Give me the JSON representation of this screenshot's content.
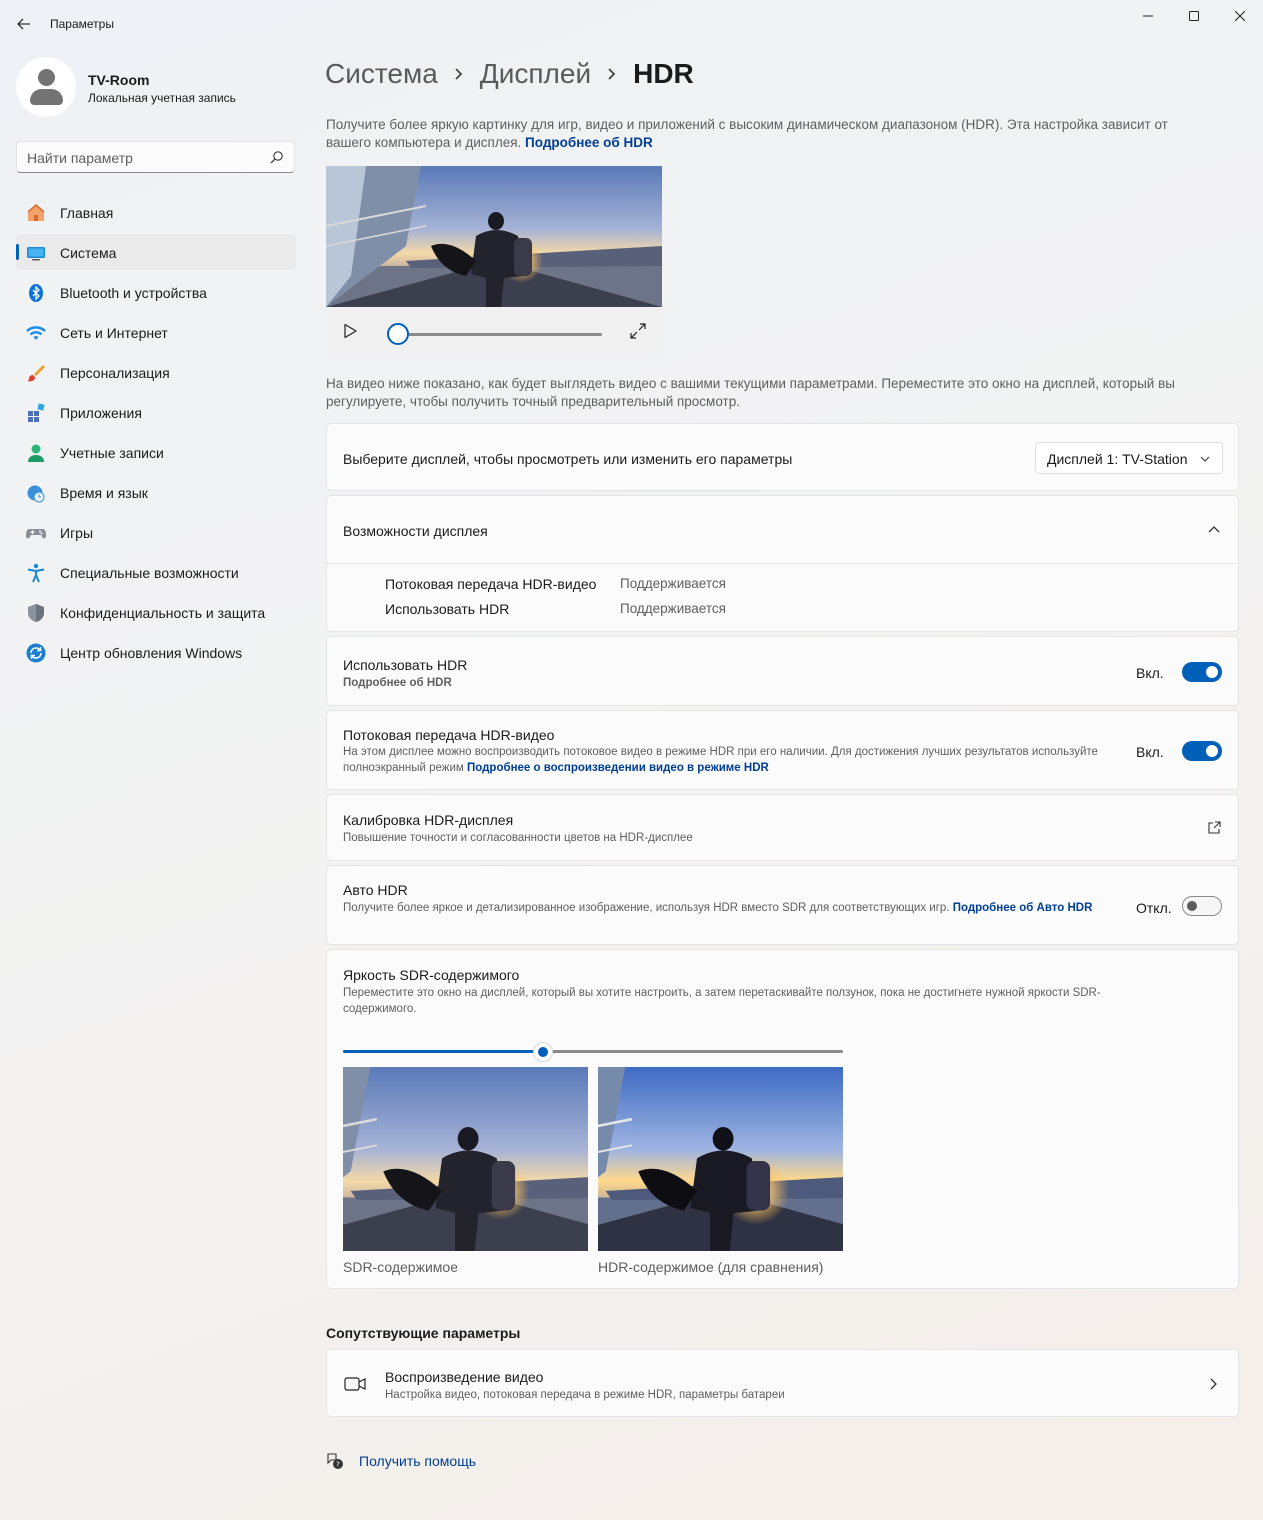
{
  "window": {
    "title": "Параметры"
  },
  "profile": {
    "name": "TV-Room",
    "account_type": "Локальная учетная запись"
  },
  "search": {
    "placeholder": "Найти параметр"
  },
  "sidebar": {
    "items": [
      {
        "label": "Главная",
        "icon": "home-icon",
        "active": false
      },
      {
        "label": "Система",
        "icon": "system-icon",
        "active": true
      },
      {
        "label": "Bluetooth и устройства",
        "icon": "bluetooth-icon",
        "active": false
      },
      {
        "label": "Сеть и Интернет",
        "icon": "wifi-icon",
        "active": false
      },
      {
        "label": "Персонализация",
        "icon": "brush-icon",
        "active": false
      },
      {
        "label": "Приложения",
        "icon": "apps-icon",
        "active": false
      },
      {
        "label": "Учетные записи",
        "icon": "accounts-icon",
        "active": false
      },
      {
        "label": "Время и язык",
        "icon": "clock-globe-icon",
        "active": false
      },
      {
        "label": "Игры",
        "icon": "gamepad-icon",
        "active": false
      },
      {
        "label": "Специальные возможности",
        "icon": "accessibility-icon",
        "active": false
      },
      {
        "label": "Конфиденциальность и защита",
        "icon": "shield-icon",
        "active": false
      },
      {
        "label": "Центр обновления Windows",
        "icon": "update-icon",
        "active": false
      }
    ]
  },
  "breadcrumb": {
    "items": [
      "Система",
      "Дисплей",
      "HDR"
    ]
  },
  "intro": {
    "text": "Получите более яркую картинку для игр, видео и приложений с высоким динамическом диапазоном (HDR). Эта настройка зависит от вашего компьютера и дисплея. ",
    "link": "Подробнее об HDR"
  },
  "video_preview": {
    "progress_percent": 0
  },
  "preview_note": "На видео ниже показано, как будет выглядеть видео с вашими текущими параметрами. Переместите это окно на дисплей, который вы регулируете, чтобы получить точный предварительный просмотр.",
  "display_select": {
    "label": "Выберите дисплей, чтобы просмотреть или изменить его параметры",
    "selected": "Дисплей 1: TV-Station"
  },
  "capabilities": {
    "title": "Возможности дисплея",
    "rows": [
      {
        "name": "Потоковая передача HDR-видео",
        "value": "Поддерживается"
      },
      {
        "name": "Использовать HDR",
        "value": "Поддерживается"
      }
    ]
  },
  "use_hdr": {
    "title": "Использовать HDR",
    "link": "Подробнее об HDR",
    "state_label": "Вкл.",
    "on": true
  },
  "hdr_streaming": {
    "title": "Потоковая передача HDR-видео",
    "desc": "На этом дисплее можно воспроизводить потоковое видео в режиме HDR при его наличии. Для достижения лучших результатов используйте полноэкранный режим  ",
    "link": "Подробнее о воспроизведении видео в режиме HDR",
    "state_label": "Вкл.",
    "on": true
  },
  "calibration": {
    "title": "Калибровка HDR-дисплея",
    "desc": "Повышение точности и согласованности цветов на HDR-дисплее"
  },
  "auto_hdr": {
    "title": "Авто HDR",
    "desc": "Получите более яркое и детализированное изображение, используя HDR вместо SDR для соответствующих игр. ",
    "link": "Подробнее об Авто HDR",
    "state_label": "Откл.",
    "on": false
  },
  "sdr_brightness": {
    "title": "Яркость SDR-содержимого",
    "desc": "Переместите это окно на дисплей, который вы хотите настроить, а затем перетаскивайте ползунок, пока не достигнете нужной яркости SDR-содержимого.",
    "slider_percent": 40,
    "sdr_caption": "SDR-содержимое",
    "hdr_caption": "HDR-содержимое (для сравнения)"
  },
  "related": {
    "heading": "Сопутствующие параметры",
    "items": [
      {
        "title": "Воспроизведение видео",
        "desc": "Настройка видео, потоковая передача в режиме HDR, параметры батареи"
      }
    ]
  },
  "help": {
    "label": "Получить помощь"
  },
  "colors": {
    "accent": "#005fb8",
    "link": "#003e92"
  }
}
